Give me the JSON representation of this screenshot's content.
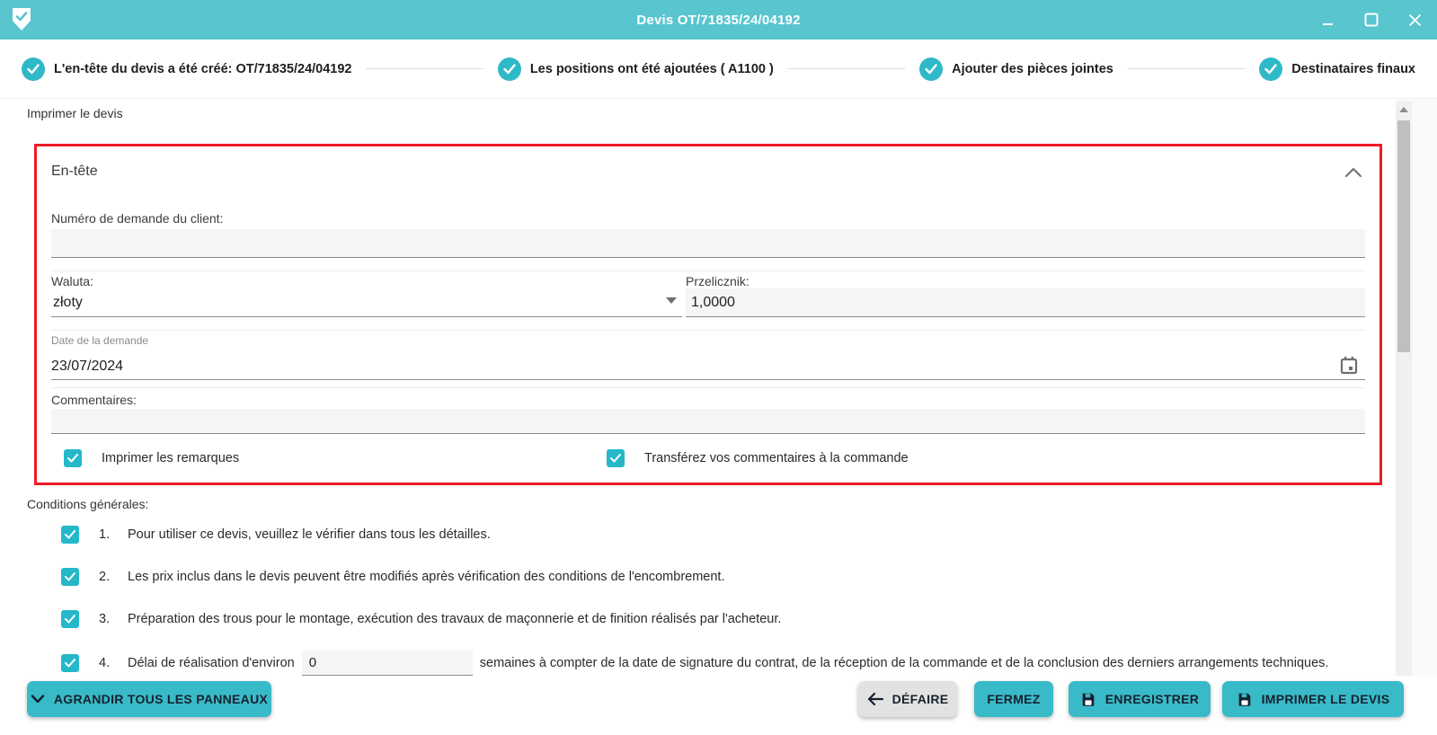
{
  "window": {
    "title": "Devis OT/71835/24/04192"
  },
  "colors": {
    "header_teal": "#58c5cf",
    "accent_teal": "#2fb9c8",
    "highlight_red": "#ec1c24",
    "button_text": "#16222e"
  },
  "stepper": {
    "steps": [
      {
        "label": "L'en-tête du devis a été créé: OT/71835/24/04192",
        "completed": true
      },
      {
        "label": "Les positions ont été ajoutées ( A1100 )",
        "completed": true
      },
      {
        "label": "Ajouter des pièces jointes",
        "completed": true
      },
      {
        "label": "Destinataires finaux",
        "completed": true
      }
    ]
  },
  "content": {
    "print_quote_label": "Imprimer le devis"
  },
  "header_panel": {
    "title": "En-tête",
    "client_request_number": {
      "label": "Numéro de demande du client:",
      "value": ""
    },
    "currency": {
      "label": "Waluta:",
      "value": "złoty"
    },
    "converter": {
      "label": "Przelicznik:",
      "value": "1,0000"
    },
    "request_date": {
      "label": "Date de la demande",
      "value": "23/07/2024"
    },
    "comments": {
      "label": "Commentaires:",
      "value": ""
    },
    "print_remarks_checkbox": {
      "label": "Imprimer les remarques",
      "checked": true
    },
    "transfer_comments_checkbox": {
      "label": "Transférez vos commentaires à la commande",
      "checked": true
    }
  },
  "conditions": {
    "label": "Conditions générales:",
    "items": [
      {
        "number": "1.",
        "text": "Pour utiliser ce devis, veuillez le vérifier dans tous les détailles.",
        "checked": true
      },
      {
        "number": "2.",
        "text": "Les prix inclus dans le devis peuvent être modifiés après vérification des conditions de l'encombrement.",
        "checked": true
      },
      {
        "number": "3.",
        "text": "Préparation des trous pour le montage, exécution des travaux de maçonnerie et de finition réalisés par l'acheteur.",
        "checked": true
      },
      {
        "number": "4.",
        "text_before": "Délai de réalisation d'environ",
        "input_value": "0",
        "text_after": "semaines à compter de la date de signature du contrat, de la réception de la commande et de la conclusion des derniers arrangements techniques.",
        "checked": true
      }
    ]
  },
  "footer": {
    "expand_all_label": "AGRANDIR TOUS LES PANNEAUX",
    "undo_label": "DÉFAIRE",
    "close_label": "FERMEZ",
    "save_label": "ENREGISTRER",
    "print_quote_label": "IMPRIMER LE DEVIS"
  }
}
